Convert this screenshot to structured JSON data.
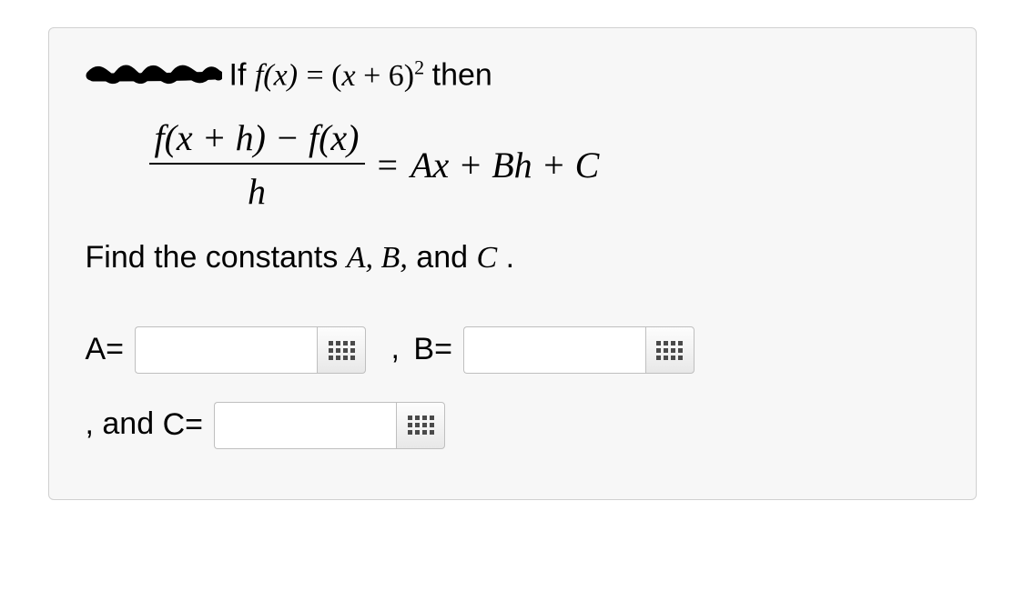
{
  "problem": {
    "intro_prefix": "If ",
    "func_def_lhs": "f(x)",
    "func_def_eq": " = ",
    "func_def_rhs_base": "(x + 6)",
    "func_def_rhs_exp": "2",
    "intro_suffix": " then",
    "diffquot_num": "f(x + h) − f(x)",
    "diffquot_den": "h",
    "eq_sign": "=",
    "rhs": "Ax + Bh + C",
    "instruction_prefix": "Find the constants ",
    "instruction_vars": "A, B,",
    "instruction_mid": " and ",
    "instruction_lastvar": "C",
    "instruction_period": "."
  },
  "answers": {
    "A_label": "A=",
    "A_value": "",
    "sep1": ", ",
    "B_label": "B=",
    "B_value": "",
    "sep2": ", and ",
    "C_label": "C=",
    "C_value": ""
  }
}
